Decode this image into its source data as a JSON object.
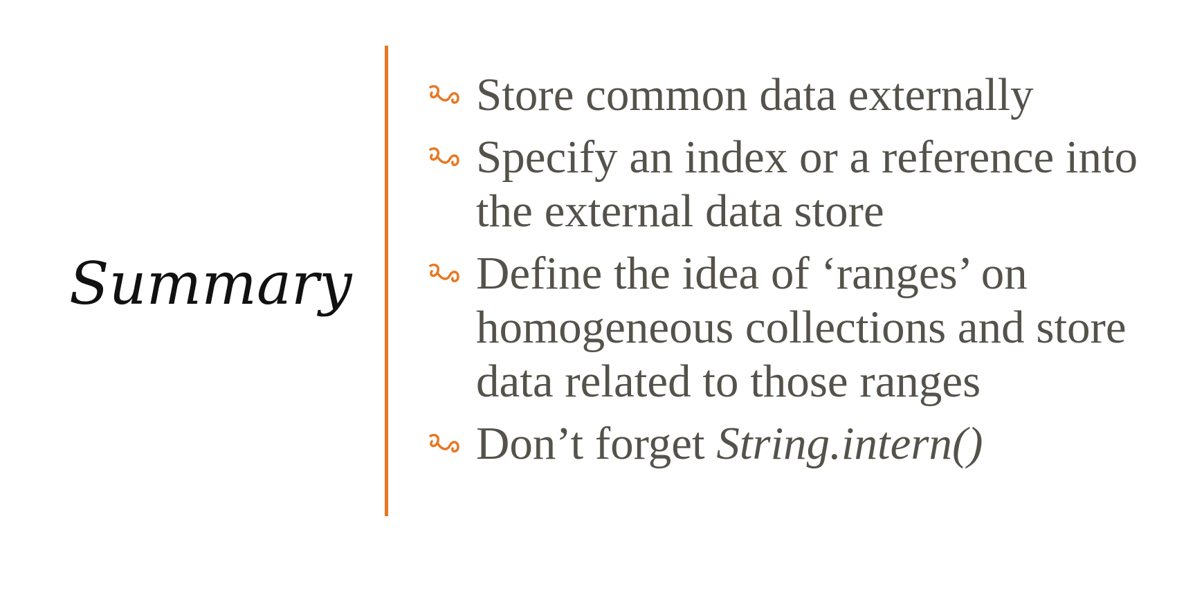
{
  "slide": {
    "title": "Summary",
    "accent_color": "#e87722",
    "text_color": "#54524a",
    "bullet_icon": "fleuron-icon",
    "bullets": [
      {
        "text": "Store common data externally"
      },
      {
        "text": "Specify an index or a reference into the external data store"
      },
      {
        "text": "Define the idea of ‘ranges’ on homogeneous collections and store data related to those ranges"
      },
      {
        "text": "Don’t forget ",
        "emphasis": "String.intern()"
      }
    ]
  }
}
